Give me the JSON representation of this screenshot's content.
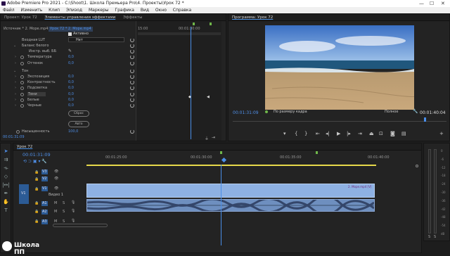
{
  "window": {
    "title": "Adobe Premiere Pro 2021 - C:\\Shoot\\1. Школа Премьера Pro\\4. Проекты\\Урок 72 *"
  },
  "menu": [
    "Файл",
    "Изменить",
    "Клип",
    "Эпизод",
    "Маркеры",
    "Графика",
    "Вид",
    "Окно",
    "Справка"
  ],
  "source_panel": {
    "tabs": [
      "Проект: Урок 72",
      "Элементы управления эффектами",
      "Эффекты"
    ],
    "breadcrumb_source": "Источник * 2. Море.mp4",
    "breadcrumb_seq": "Урок 72 * 2. Море.mp4",
    "active_label": "Активно",
    "input_lut_label": "Входная LUT",
    "input_lut_value": "Нет",
    "white_balance": "Баланс белого",
    "eyedropper_label": "Инстр. выб. ББ",
    "rows": [
      {
        "label": "Температура",
        "value": "0,0"
      },
      {
        "label": "Оттенок",
        "value": "0,0"
      },
      {
        "label": "Тон",
        "value": ""
      },
      {
        "label": "Экспозиция",
        "value": "0,0"
      },
      {
        "label": "Контрастность",
        "value": "0,0"
      },
      {
        "label": "Подсветка",
        "value": "0,0"
      },
      {
        "label": "Тени",
        "value": "0,0"
      },
      {
        "label": "Белые",
        "value": "0,0"
      },
      {
        "label": "Черные",
        "value": "0,0"
      }
    ],
    "reset_btn": "Сброс",
    "auto_btn": "Авто",
    "saturation_label": "Насыщенность",
    "saturation_value": "100,0",
    "timecode": "00:01:31:09",
    "ruler_start": "15:00",
    "ruler_mid": "00:01:30:00"
  },
  "program": {
    "title": "Программа: Урок 72",
    "timecode": "00:01:31:09",
    "fit": "По размеру кадра",
    "quality": "Полное",
    "duration": "00:01:40:04"
  },
  "timeline": {
    "tab": "Урок 72",
    "timecode": "00:01:31:09",
    "ruler": [
      "00:01:25:00",
      "00:01:30:00",
      "00:01:35:00",
      "00:01:40:00"
    ],
    "tracks": [
      {
        "name": "V3"
      },
      {
        "name": "V2"
      },
      {
        "name": "V1",
        "label": "Видео 1"
      },
      {
        "name": "A1"
      },
      {
        "name": "A2"
      },
      {
        "name": "A3"
      }
    ],
    "src_track": "V1",
    "src_track_a": "A1",
    "clip_label": "2. Море.mp4 [V]",
    "m": "M",
    "s": "S"
  },
  "meter_labels": [
    "0",
    "-6",
    "-12",
    "-18",
    "-24",
    "-30",
    "-36",
    "-42",
    "-48",
    "-54",
    "dB"
  ],
  "meter_bottom": [
    "S",
    "S"
  ],
  "watermark": "Школа ПП",
  "colors": {
    "accent": "#4f8fe8",
    "clip_video": "#8eb1e3",
    "clip_audio": "#6e8fbf",
    "playhead": "#4a8ee8",
    "ruler_line": "#e6d94a"
  }
}
